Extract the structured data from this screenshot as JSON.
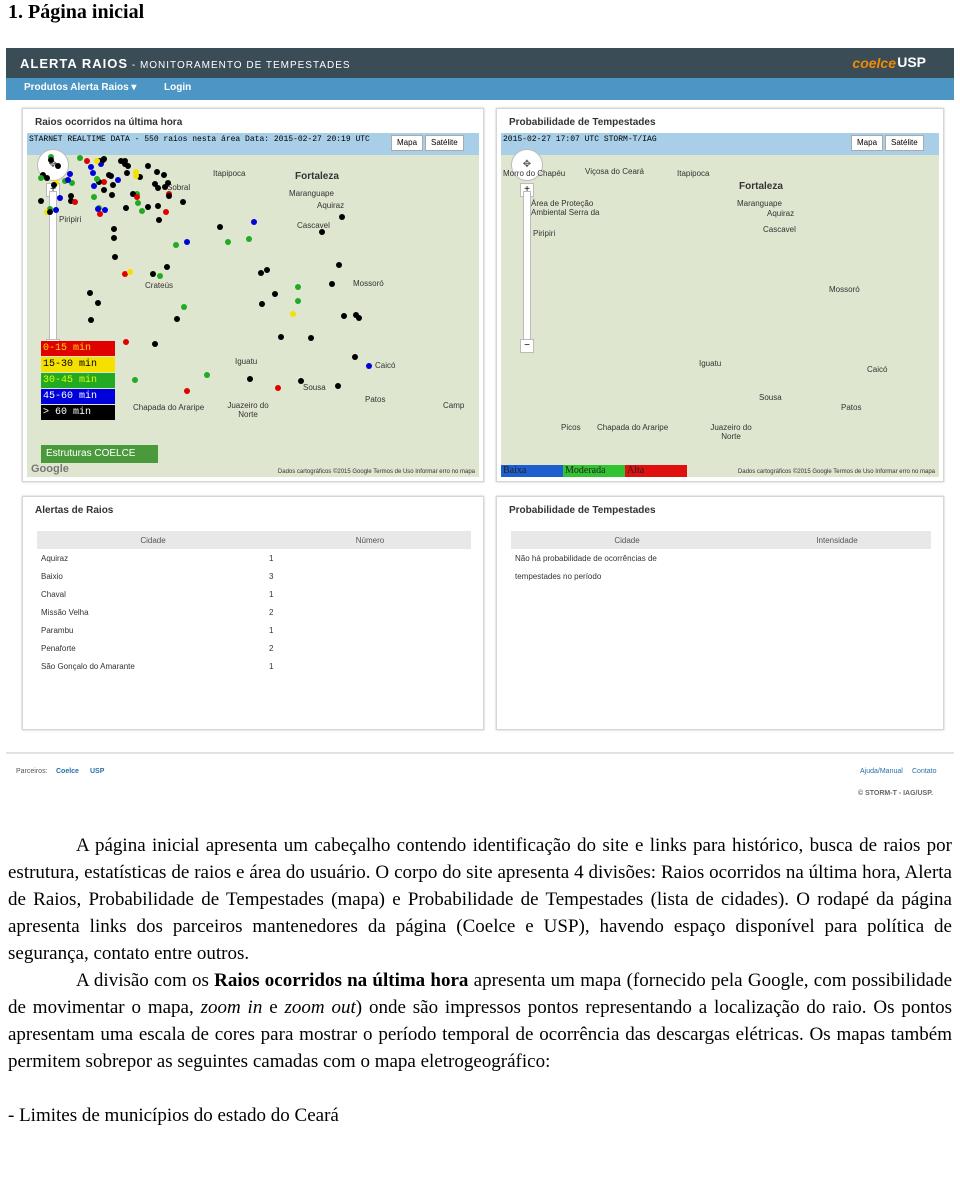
{
  "doc": {
    "heading": "1. Página inicial",
    "p1": "A página inicial apresenta um cabeçalho contendo identificação do site e links para histórico, busca de raios por estrutura, estatísticas de raios e área do usuário. O corpo do site apresenta 4 divisões: Raios ocorridos na última hora, Alerta de Raios, Probabilidade de Tempestades (mapa) e Probabilidade de Tempestades (lista de cidades). O rodapé da página apresenta links dos parceiros mantenedores da página (Coelce e USP), havendo espaço disponível para política de segurança, contato entre outros.",
    "p2_a": "A divisão com os ",
    "p2_bold": "Raios ocorridos na última hora",
    "p2_b": " apresenta um mapa (fornecido pela Google, com possibilidade de movimentar o mapa, ",
    "p2_em1": "zoom in",
    "p2_c": " e ",
    "p2_em2": "zoom out",
    "p2_d": ") onde são impressos pontos representando a localização do raio. Os pontos apresentam uma escala de cores para mostrar o período temporal de ocorrência das descargas elétricas. Os mapas também permitem sobrepor as seguintes camadas com o mapa eletrogeográfico:",
    "p3": "- Limites de municípios do estado do Ceará"
  },
  "site": {
    "logo_main": "ALERTA RAIOS",
    "logo_sub": " - MONITORAMENTO DE TEMPESTADES",
    "brand_coelce": "coelce",
    "brand_usp": "USP",
    "nav": [
      "Produtos Alerta Raios ▾",
      "Login"
    ]
  },
  "panels": {
    "raios_title": "Raios ocorridos na última hora",
    "raios_header": "STARNET REALTIME DATA - 550 raios nesta área    Data: 2015-02-27 20:19 UTC",
    "prob_map_title": "Probabilidade de Tempestades",
    "prob_map_header": "2015-02-27 17:07 UTC STORM-T/IAG",
    "map_btn": "Mapa",
    "sat_btn": "Satélite",
    "alertas_title": "Alertas de Raios",
    "prob_list_title": "Probabilidade de Tempestades"
  },
  "cities": {
    "fortaleza": "Fortaleza",
    "maranguape": "Maranguape",
    "cascavel": "Cascavel",
    "aquiraz": "Aquiraz",
    "itapipoca": "Itapipoca",
    "sobral": "Sobral",
    "piripiri": "Piripiri",
    "crateus": "Crateús",
    "mossoro": "Mossoró",
    "iguatu": "Iguatu",
    "sousa": "Sousa",
    "caico": "Caicó",
    "patos": "Patos",
    "juazeiro": "Juazeiro do Norte",
    "chapada": "Chapada do Araripe",
    "picos": "Picos",
    "morro": "Morro do Chapéu",
    "area": "Área de Proteção Ambiental Serra da",
    "vicosa": "Viçosa do Ceará",
    "camp": "Camp"
  },
  "legend": {
    "items": [
      {
        "label": "0-15 min",
        "color": "#e00000"
      },
      {
        "label": "15-30 min",
        "color": "#f5e000"
      },
      {
        "label": "30-45 min",
        "color": "#22aa22"
      },
      {
        "label": "45-60 min",
        "color": "#0000dd"
      },
      {
        "label": "> 60 min",
        "color": "#000000"
      }
    ],
    "structures": "Estruturas COELCE",
    "prob": [
      {
        "label": "Baixa",
        "color": "#1e5fd0"
      },
      {
        "label": "Moderada",
        "color": "#31c331"
      },
      {
        "label": "Alta",
        "color": "#e01010"
      }
    ]
  },
  "map_footer": {
    "google": "Google",
    "credits": "Dados cartográficos ©2015 Google   Termos de Uso   Informar erro no mapa"
  },
  "alertas_table": {
    "headers": [
      "Cidade",
      "Número"
    ],
    "rows": [
      [
        "Aquiraz",
        "1"
      ],
      [
        "Baixio",
        "3"
      ],
      [
        "Chaval",
        "1"
      ],
      [
        "Missão Velha",
        "2"
      ],
      [
        "Parambu",
        "1"
      ],
      [
        "Penaforte",
        "2"
      ],
      [
        "São Gonçalo do Amarante",
        "1"
      ]
    ]
  },
  "prob_table": {
    "headers": [
      "Cidade",
      "Intensidade"
    ],
    "empty_line1": "Não há probabilidade de ocorrências de",
    "empty_line2": "tempestades no período"
  },
  "footer": {
    "partners_label": "Parceiros:",
    "partner1": "Coelce",
    "partner2": "USP",
    "help": "Ajuda/Manual",
    "contact": "Contato",
    "copyright": "© STORM-T - IAG/USP."
  },
  "colors": {
    "topbar": "#3a4c55",
    "navbar": "#4b96c5",
    "structures_green": "#4a9a3c"
  }
}
